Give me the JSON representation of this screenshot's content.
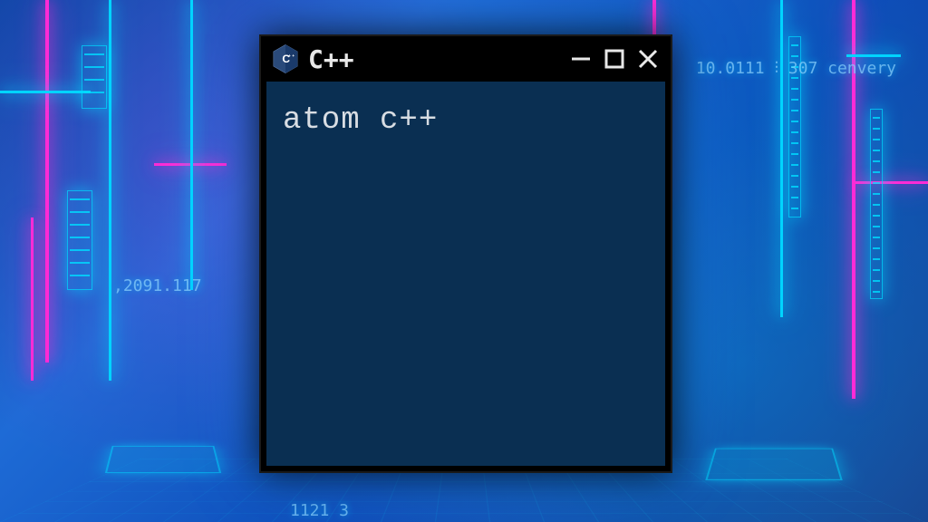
{
  "window": {
    "title": "C++",
    "body_text": "atom c++"
  },
  "background": {
    "text_top_right": "10.0111 ⫶ 307  cenvery",
    "text_mid_left": ",2091.117",
    "text_bottom": "1121 3"
  },
  "colors": {
    "neon_pink": "#ff2bd6",
    "neon_cyan": "#00d4ff",
    "terminal_bg": "#0a2f52",
    "terminal_fg": "#d8dde3"
  }
}
